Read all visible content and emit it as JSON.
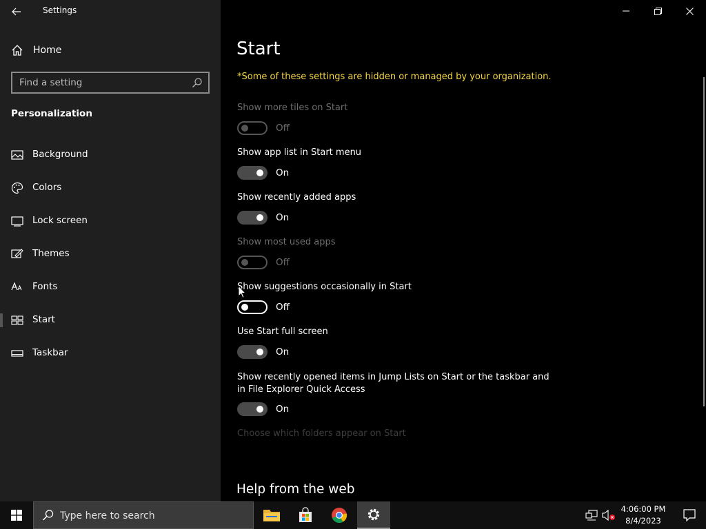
{
  "window": {
    "app_title": "Settings"
  },
  "sidebar": {
    "home_label": "Home",
    "search_placeholder": "Find a setting",
    "section_title": "Personalization",
    "items": [
      {
        "label": "Background",
        "icon": "image-icon"
      },
      {
        "label": "Colors",
        "icon": "palette-icon"
      },
      {
        "label": "Lock screen",
        "icon": "lock-screen-icon"
      },
      {
        "label": "Themes",
        "icon": "themes-icon"
      },
      {
        "label": "Fonts",
        "icon": "fonts-icon"
      },
      {
        "label": "Start",
        "icon": "start-icon",
        "selected": true
      },
      {
        "label": "Taskbar",
        "icon": "taskbar-icon"
      }
    ]
  },
  "main": {
    "title": "Start",
    "org_note": "*Some of these settings are hidden or managed by your organization.",
    "settings": [
      {
        "name": "Show more tiles on Start",
        "state": "Off",
        "enabled": false
      },
      {
        "name": "Show app list in Start menu",
        "state": "On",
        "enabled": true
      },
      {
        "name": "Show recently added apps",
        "state": "On",
        "enabled": true
      },
      {
        "name": "Show most used apps",
        "state": "Off",
        "enabled": false
      },
      {
        "name": "Show suggestions occasionally in Start",
        "state": "Off",
        "enabled": true
      },
      {
        "name": "Use Start full screen",
        "state": "On",
        "enabled": true
      },
      {
        "name": "Show recently opened items in Jump Lists on Start or the taskbar and in File Explorer Quick Access",
        "state": "On",
        "enabled": true
      }
    ],
    "folders_link": "Choose which folders appear on Start",
    "help_title": "Help from the web"
  },
  "taskbar": {
    "search_placeholder": "Type here to search",
    "time": "4:06:00 PM",
    "date": "8/4/2023"
  },
  "colors": {
    "accent_note": "#f5d742",
    "sidebar_bg": "#1f1f1f",
    "content_bg": "#000000"
  }
}
